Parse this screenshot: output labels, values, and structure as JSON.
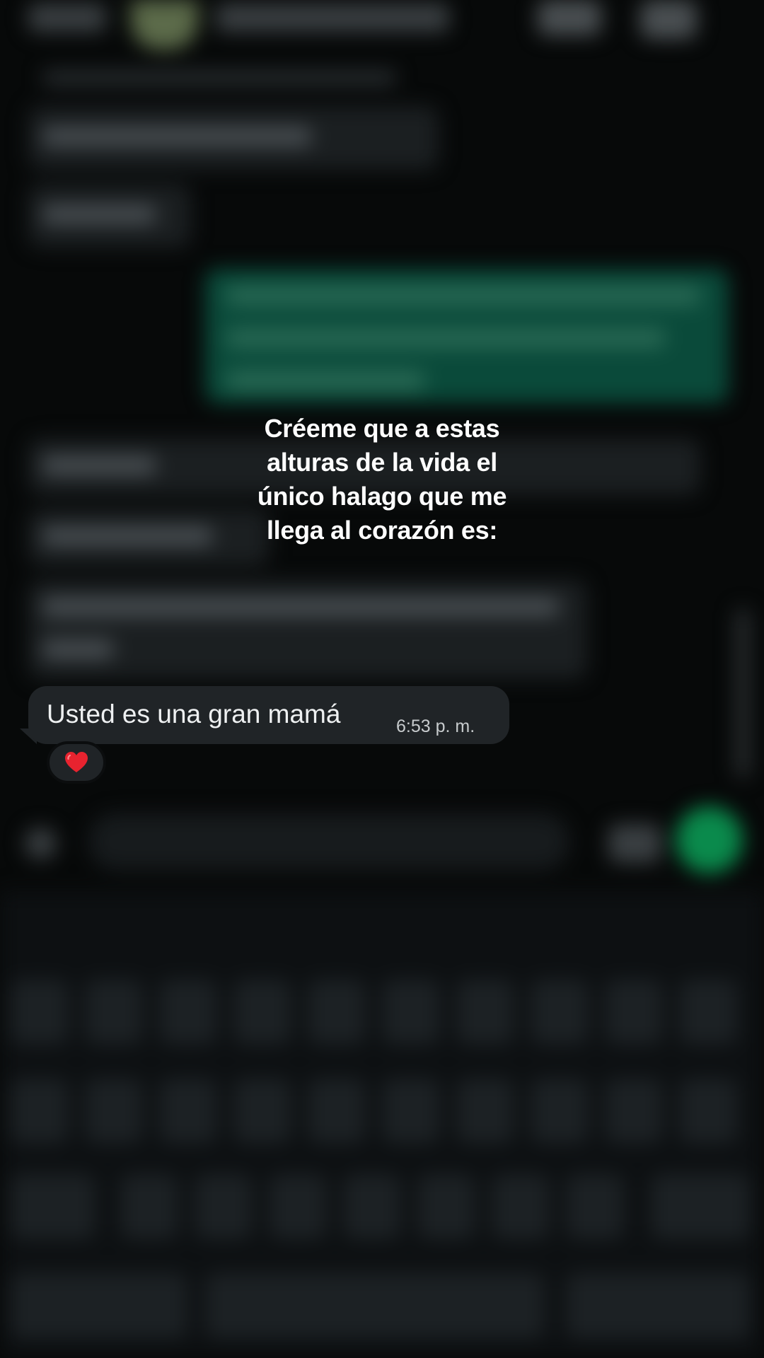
{
  "overlay": {
    "caption": "Créeme que a estas\nalturas de la vida el\núnico halago que me\nllega al corazón es:"
  },
  "message": {
    "text": "Usted es una gran mamá",
    "time": "6:53 p. m.",
    "reaction": "❤️"
  },
  "colors": {
    "bubble_incoming": "#202427",
    "send_button": "#0a8a4c",
    "outgoing_bubble": "#0a4a3a",
    "heart": "#e8232f"
  },
  "icons": {
    "camera": "camera-icon",
    "call": "phone-icon",
    "attach": "plus-icon",
    "send": "send-icon"
  }
}
